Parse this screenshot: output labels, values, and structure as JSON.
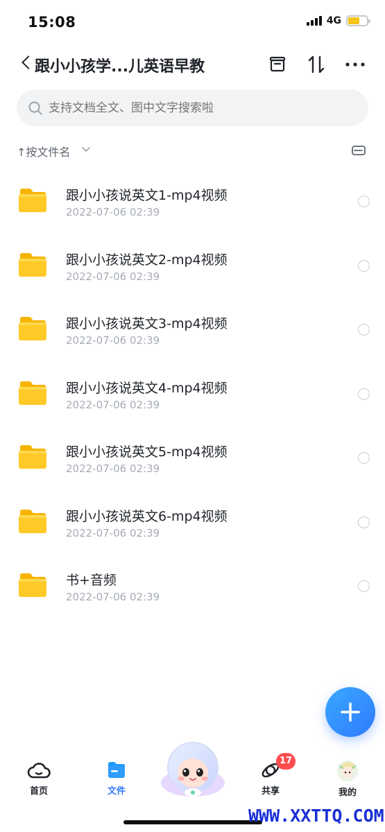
{
  "status_bar": {
    "time": "15:08",
    "network": "4G",
    "battery_color": "#f5c518"
  },
  "header": {
    "title": "跟小小孩学...儿英语早教",
    "back_icon": "chevron-left-icon",
    "actions": [
      "archive-icon",
      "sort-icon",
      "more-icon"
    ]
  },
  "search": {
    "placeholder": "支持文档全文、图中文字搜索啦"
  },
  "sort": {
    "label": "↑按文件名",
    "view_icon": "list-view-icon"
  },
  "files": [
    {
      "name": "跟小小孩说英文1-mp4视频",
      "date": "2022-07-06 02:39"
    },
    {
      "name": "跟小小孩说英文2-mp4视频",
      "date": "2022-07-06 02:39"
    },
    {
      "name": "跟小小孩说英文3-mp4视频",
      "date": "2022-07-06 02:39"
    },
    {
      "name": "跟小小孩说英文4-mp4视频",
      "date": "2022-07-06 02:39"
    },
    {
      "name": "跟小小孩说英文5-mp4视频",
      "date": "2022-07-06 02:39"
    },
    {
      "name": "跟小小孩说英文6-mp4视频",
      "date": "2022-07-06 02:39"
    },
    {
      "name": "书+音频",
      "date": "2022-07-06 02:39"
    }
  ],
  "fab": {
    "icon": "plus-icon",
    "color": "#2f7bff"
  },
  "bottom_nav": {
    "items": [
      {
        "label": "首页",
        "icon": "cloud-icon"
      },
      {
        "label": "文件",
        "icon": "folder-icon",
        "active": true
      },
      {
        "label": "共享",
        "icon": "orbit-icon",
        "badge": "17"
      },
      {
        "label": "我的",
        "icon": "avatar-icon"
      }
    ],
    "center_icon": "mascot-icon"
  },
  "colors": {
    "accent": "#2f7bff",
    "folder": "#ffc928",
    "badge": "#ff4d4f"
  },
  "watermark": "WWW.XXTTQ.COM"
}
